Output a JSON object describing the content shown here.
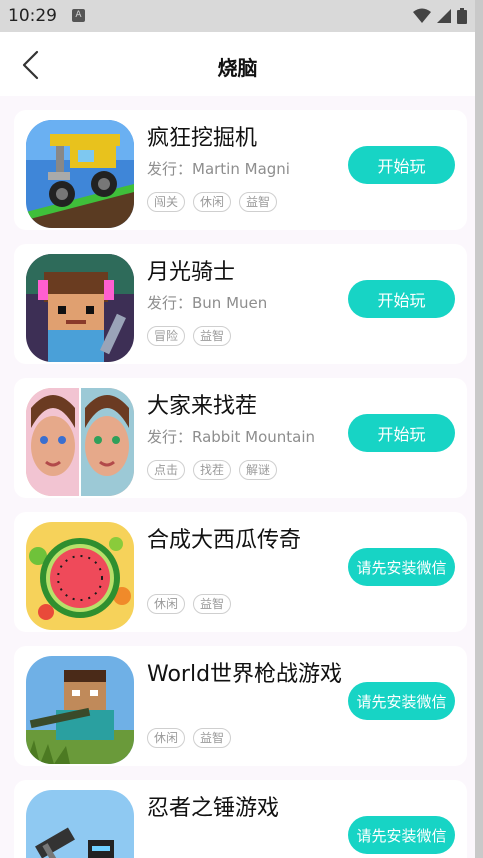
{
  "status": {
    "time": "10:29",
    "notif": "A"
  },
  "header": {
    "title": "烧脑"
  },
  "games": [
    {
      "name": "疯狂挖掘机",
      "publisher": "发行：Martin Magni",
      "tags": [
        "闯关",
        "休闲",
        "益智"
      ],
      "button": "开始玩"
    },
    {
      "name": "月光骑士",
      "publisher": "发行：Bun Muen",
      "tags": [
        "冒险",
        "益智"
      ],
      "button": "开始玩"
    },
    {
      "name": "大家来找茬",
      "publisher": "发行：Rabbit Mountain",
      "tags": [
        "点击",
        "找茬",
        "解谜"
      ],
      "button": "开始玩"
    },
    {
      "name": "合成大西瓜传奇",
      "publisher": "",
      "tags": [
        "休闲",
        "益智"
      ],
      "button": "请先安装微信"
    },
    {
      "name": "World世界枪战游戏",
      "publisher": "",
      "tags": [
        "休闲",
        "益智"
      ],
      "button": "请先安装微信"
    },
    {
      "name": "忍者之锤游戏",
      "publisher": "",
      "tags": [],
      "button": "请先安装微信"
    }
  ]
}
